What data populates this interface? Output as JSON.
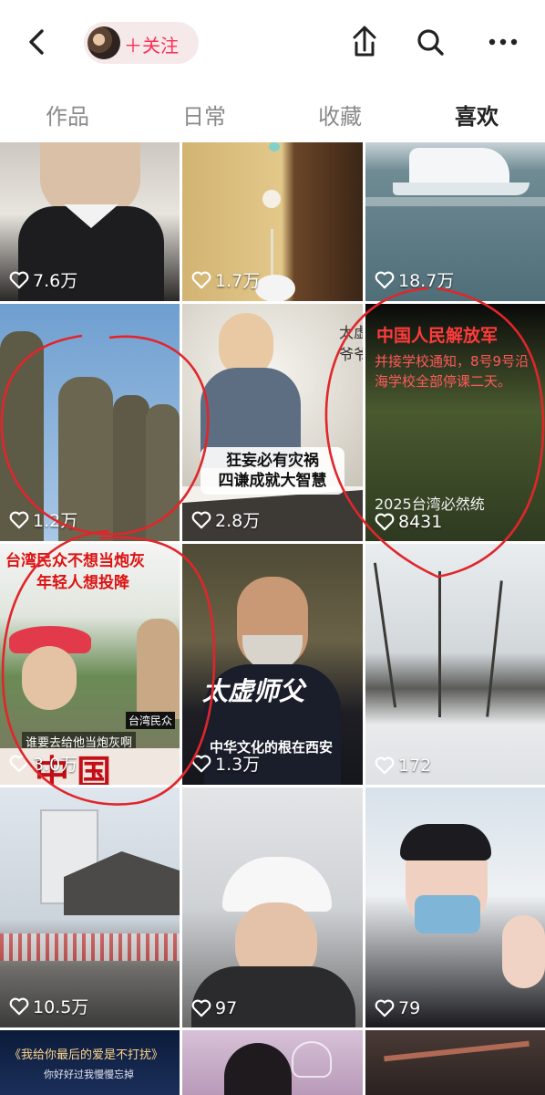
{
  "header": {
    "follow_label": "＋关注",
    "icons": [
      "back-arrow-icon",
      "avatar",
      "share-icon",
      "search-icon",
      "more-icon"
    ]
  },
  "tabs": [
    {
      "label": "作品",
      "active": false
    },
    {
      "label": "日常",
      "active": false
    },
    {
      "label": "收藏",
      "active": false
    },
    {
      "label": "喜欢",
      "active": true
    }
  ],
  "videos": [
    {
      "likes": "7.6万"
    },
    {
      "likes": "1.7万"
    },
    {
      "likes": "18.7万"
    },
    {
      "likes": "1.2万"
    },
    {
      "likes": "2.8万",
      "text": {
        "side_chars": [
          "太",
          "虚",
          "爷",
          "爷"
        ],
        "caption_1": "狂妄必有灾祸",
        "caption_2": "四谦成就大智慧"
      }
    },
    {
      "likes": "8431",
      "text": {
        "title": "中国人民解放军",
        "body": "并接学校通知，8号9号沿海学校全部停课二天。",
        "footer": "2025台湾必然统"
      }
    },
    {
      "likes": "3.0万",
      "text": {
        "title_1": "台湾民众不想当炮灰",
        "title_2": "年轻人想投降",
        "badge": "台湾民众",
        "subtitle": "谁要去给他当炮灰啊",
        "big": "中国"
      }
    },
    {
      "likes": "1.3万",
      "text": {
        "big": "太虚师父",
        "caption": "中华文化的根在西安"
      }
    },
    {
      "likes": "172"
    },
    {
      "likes": "10.5万"
    },
    {
      "likes": "97"
    },
    {
      "likes": "79"
    },
    {
      "likes": "",
      "text": {
        "title": "《我给你最后的爱是不打扰》",
        "subtitle": "你好好过我慢慢忘掉"
      }
    },
    {
      "likes": ""
    },
    {
      "likes": ""
    }
  ],
  "colors": {
    "accent": "#fe2c55",
    "annotation": "#e0262b"
  }
}
